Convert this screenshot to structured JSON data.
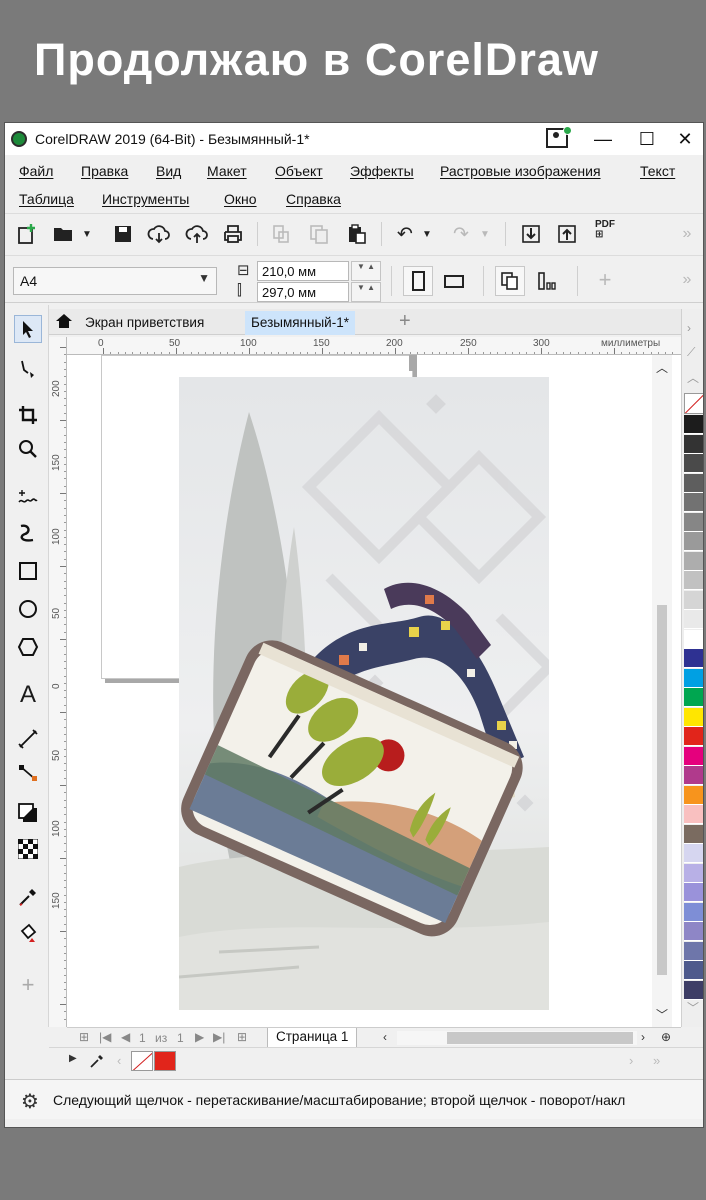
{
  "banner": {
    "title": "Продолжаю в CorelDraw"
  },
  "window": {
    "title": "CorelDRAW 2019 (64-Bit) - Безымянный-1*",
    "min_glyph": "—",
    "max_glyph": "☐",
    "close_glyph": "✕"
  },
  "menu": {
    "row1": [
      "Файл",
      "Правка",
      "Вид",
      "Макет",
      "Объект",
      "Эффекты",
      "Растровые изображения",
      "Текст"
    ],
    "row2": [
      "Таблица",
      "Инструменты",
      "Окно",
      "Справка"
    ]
  },
  "toolbar": {
    "pdf_label": "PDF",
    "overflow_glyph": "»"
  },
  "property_bar": {
    "paper_size": "A4",
    "width": "210,0 мм",
    "height": "297,0 мм",
    "add_glyph": "+",
    "overflow_glyph": "»"
  },
  "doc_tabs": {
    "welcome": "Экран приветствия",
    "current": "Безымянный-1*",
    "add_glyph": "+"
  },
  "rulers": {
    "horizontal": [
      "0",
      "50",
      "100",
      "150",
      "200",
      "250",
      "300"
    ],
    "unit": "миллиметры",
    "vertical": [
      "200",
      "150",
      "100",
      "50",
      "0",
      "50",
      "100",
      "150"
    ]
  },
  "page_nav": {
    "current": "1",
    "of_label": "из",
    "total": "1",
    "page_tab": "Страница 1"
  },
  "palette": {
    "colors": [
      "#1c1c1c",
      "#333333",
      "#4a4a4a",
      "#5e5e5e",
      "#727272",
      "#868686",
      "#9a9a9a",
      "#adadad",
      "#c1c1c1",
      "#d5d5d5",
      "#e9e9e9",
      "#ffffff",
      "#2e3192",
      "#00a0e3",
      "#00a650",
      "#ffe600",
      "#e1251b",
      "#e5007d",
      "#b03a8c",
      "#f7941d",
      "#f9c0c0",
      "#7a6b60",
      "#d6d6f0",
      "#b8b0e6",
      "#9a92da",
      "#7e8ed6",
      "#8e86c6",
      "#6e76aa",
      "#4e5a8c",
      "#3e3e66"
    ]
  },
  "status": {
    "text": "Следующий щелчок - перетаскивание/масштабирование; второй щелчок - поворот/накл"
  }
}
